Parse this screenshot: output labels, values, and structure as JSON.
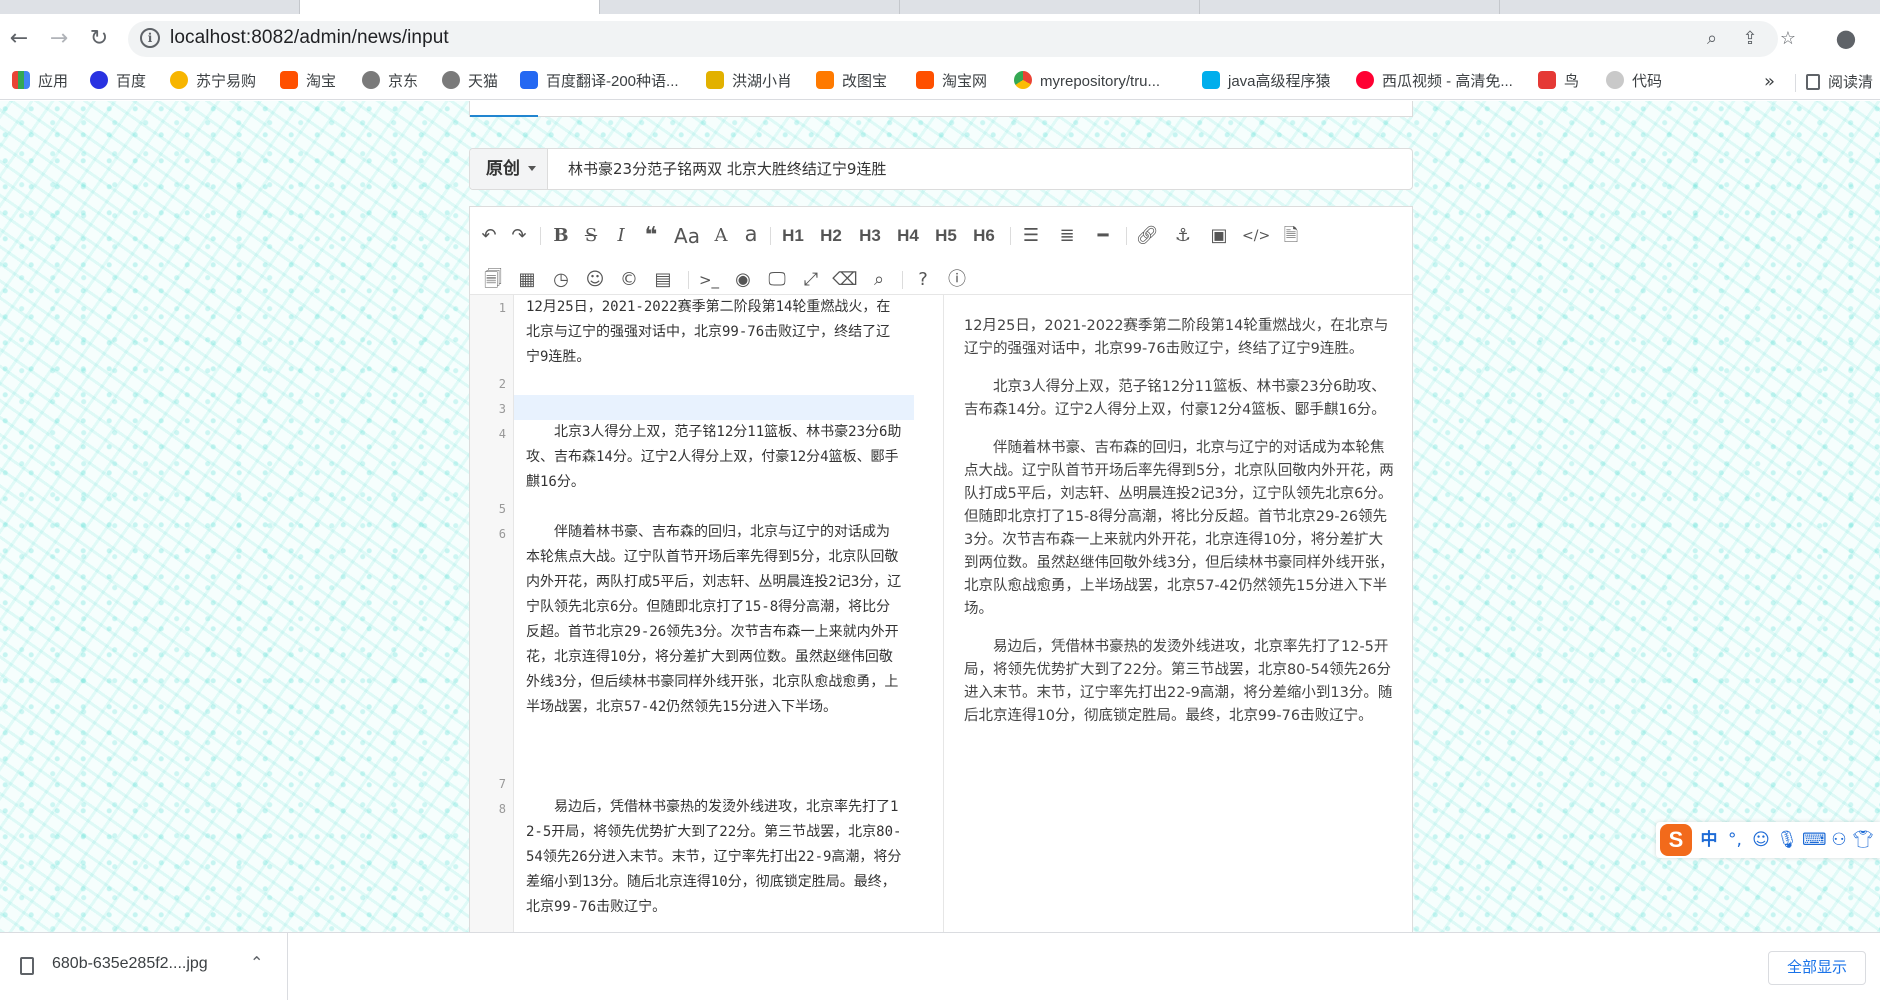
{
  "browser": {
    "url_host": "localhost",
    "url_rest": ":8082/admin/news/input",
    "bookmarks": [
      {
        "label": "应用",
        "color": "#4285f4"
      },
      {
        "label": "百度",
        "color": "#2932e1"
      },
      {
        "label": "苏宁易购",
        "color": "#f7b500"
      },
      {
        "label": "淘宝",
        "color": "#ff5000"
      },
      {
        "label": "京东",
        "color": "#7a7a7a"
      },
      {
        "label": "天猫",
        "color": "#7a7a7a"
      },
      {
        "label": "百度翻译-200种语...",
        "color": "#2468f2"
      },
      {
        "label": "洪湖小肖",
        "color": "#e2b100"
      },
      {
        "label": "改图宝",
        "color": "#ff7a00"
      },
      {
        "label": "淘宝网",
        "color": "#ff5000"
      },
      {
        "label": "myrepository/tru...",
        "color": "#34a853"
      },
      {
        "label": "java高级程序猿",
        "color": "#00aeec"
      },
      {
        "label": "西瓜视频 - 高清免...",
        "color": "#ff0032"
      },
      {
        "label": "鸟",
        "color": "#e53935"
      },
      {
        "label": "代码",
        "color": "#c9c9c9"
      }
    ],
    "bookmarks_more": "»",
    "reading_list": "阅读清"
  },
  "form": {
    "flag": "原创",
    "title_value": "林书豪23分范子铭两双 北京大胜终结辽宁9连胜"
  },
  "editor": {
    "toolbar_row1": [
      "undo-icon",
      "redo-icon",
      "bold-icon",
      "strikethrough-icon",
      "italic-icon",
      "quote-icon",
      "uppercase-icon",
      "first-letter-upper-icon",
      "lowercase-icon",
      "h1",
      "h2",
      "h3",
      "h4",
      "h5",
      "h6",
      "unordered-list-icon",
      "ordered-list-icon",
      "hr-icon",
      "link-icon",
      "anchor-icon",
      "image-icon",
      "code-icon",
      "code-block-icon"
    ],
    "headings": [
      "H1",
      "H2",
      "H3",
      "H4",
      "H5",
      "H6"
    ],
    "line_numbers": [
      "1",
      "2",
      "3",
      "4",
      "5",
      "6",
      "7",
      "8"
    ],
    "lines": [
      "12月25日，2021-2022赛季第二阶段第14轮重燃战火，在北京与辽宁的强强对话中，北京99-76击败辽宁，终结了辽宁9连胜。",
      "",
      "",
      "　　北京3人得分上双，范子铭12分11篮板、林书豪23分6助攻、吉布森14分。辽宁2人得分上双，付豪12分4篮板、郾手麒16分。",
      "",
      "　　伴随着林书豪、吉布森的回归，北京与辽宁的对话成为本轮焦点大战。辽宁队首节开场后率先得到5分，北京队回敬内外开花，两队打成5平后，刘志轩、丛明晨连投2记3分，辽宁队领先北京6分。但随即北京打了15-8得分高潮，将比分反超。首节北京29-26领先3分。次节吉布森一上来就内外开花，北京连得10分，将分差扩大到两位数。虽然赵继伟回敬外线3分，但后续林书豪同样外线开张，北京队愈战愈勇，上半场战罢，北京57-42仍然领先15分进入下半场。",
      "",
      "　　易边后，凭借林书豪热的发烫外线进攻，北京率先打了12-5开局，将领先优势扩大到了22分。第三节战罢，北京80-54领先26分进入末节。末节，辽宁率先打出22-9高潮，将分差缩小到13分。随后北京连得10分，彻底锁定胜局。最终，北京99-76击败辽宁。"
    ],
    "preview": [
      "12月25日，2021-2022赛季第二阶段第14轮重燃战火，在北京与辽宁的强强对话中，北京99-76击败辽宁，终结了辽宁9连胜。",
      "　　北京3人得分上双，范子铭12分11篮板、林书豪23分6助攻、吉布森14分。辽宁2人得分上双，付豪12分4篮板、郾手麒16分。",
      "　　伴随着林书豪、吉布森的回归，北京与辽宁的对话成为本轮焦点大战。辽宁队首节开场后率先得到5分，北京队回敬内外开花，两队打成5平后，刘志轩、丛明晨连投2记3分，辽宁队领先北京6分。但随即北京打了15-8得分高潮，将比分反超。首节北京29-26领先3分。次节吉布森一上来就内外开花，北京连得10分，将分差扩大到两位数。虽然赵继伟回敬外线3分，但后续林书豪同样外线开张，北京队愈战愈勇，上半场战罢，北京57-42仍然领先15分进入下半场。",
      "　　易边后，凭借林书豪热的发烫外线进攻，北京率先打了12-5开局，将领先优势扩大到了22分。第三节战罢，北京80-54领先26分进入末节。末节，辽宁率先打出22-9高潮，将分差缩小到13分。随后北京连得10分，彻底锁定胜局。最终，北京99-76击败辽宁。"
    ]
  },
  "ime": {
    "logo": "S",
    "mode": "中"
  },
  "downloads": {
    "file_name": "680b-635e285f2....jpg",
    "show_all": "全部显示"
  },
  "colors": {
    "accent": "#2185d0",
    "ime_orange": "#f26a1b",
    "link_blue": "#1a73e8"
  }
}
